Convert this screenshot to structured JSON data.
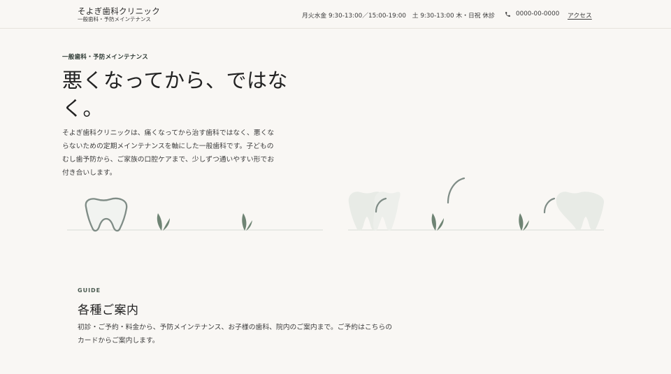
{
  "header": {
    "brand_name": "そよぎ歯科クリニック",
    "brand_sub": "一般歯科・予防メインテナンス",
    "hours": "月火水金 9:30-13:00／15:00-19:00　土 9:30-13:00 木・日祝 休診",
    "phone": "0000-00-0000",
    "access_label": "アクセス"
  },
  "hero": {
    "eyebrow": "一般歯科・予防メインテナンス",
    "title": "悪くなってから、ではなく。",
    "description": "そよぎ歯科クリニックは、痛くなってから治す歯科ではなく、悪くならないための定期メインテナンスを軸にした一般歯科です。子どものむし歯予防から、ご家族の口腔ケアまで、少しずつ通いやすい形でお付き合いします。"
  },
  "guide": {
    "eyebrow": "GUIDE",
    "title": "各種ご案内",
    "description": "初診・ご予約・料金から、予防メインテナンス、お子様の歯科、院内のご案内まで。ご予約はこちらのカードからご案内します。"
  },
  "colors": {
    "background": "#f9f7f4",
    "accent_green": "#6f8474",
    "tooth_outline": "#7f8c86",
    "faded_tooth": "#e8ebe6"
  },
  "icons": [
    "phone-icon",
    "tooth-icon",
    "leaf-icon"
  ]
}
